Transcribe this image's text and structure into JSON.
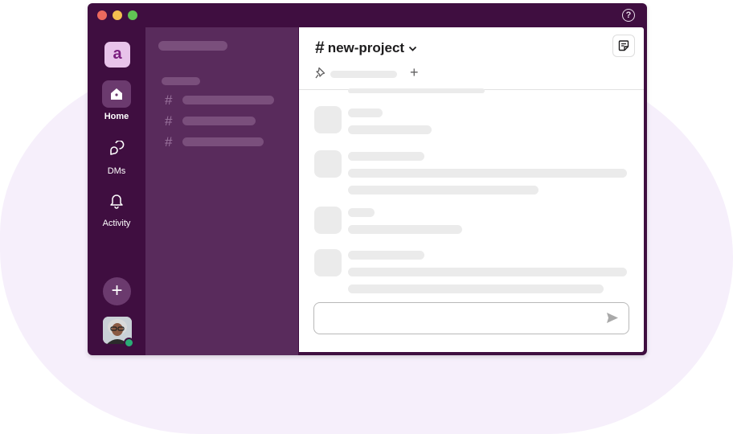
{
  "window": {
    "controls": [
      "close",
      "minimize",
      "zoom"
    ],
    "help_icon": "help-circle-icon"
  },
  "rail": {
    "workspace_letter": "a",
    "items": [
      {
        "label": "Home",
        "icon": "home-icon",
        "active": true
      },
      {
        "label": "DMs",
        "icon": "dms-icon",
        "active": false
      },
      {
        "label": "Activity",
        "icon": "bell-icon",
        "active": false
      }
    ],
    "add_icon": "plus-icon",
    "add_glyph": "+"
  },
  "channel": {
    "hash": "#",
    "name": "new-project",
    "add_glyph": "+"
  },
  "sidebar": {
    "channel_hash": "#"
  },
  "colors": {
    "aubergine": "#3f0e40",
    "sidebar": "#592b5c",
    "accent": "#7b1e7f",
    "presence": "#2bac76"
  }
}
